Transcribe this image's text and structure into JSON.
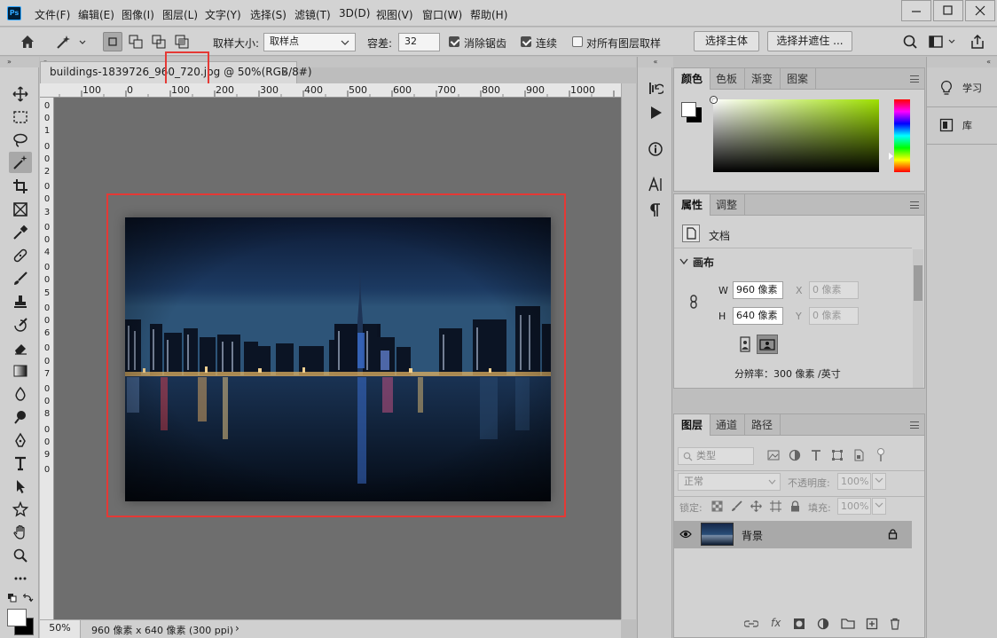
{
  "menubar": {
    "logo": "Ps",
    "items": [
      "文件(F)",
      "编辑(E)",
      "图像(I)",
      "图层(L)",
      "文字(Y)",
      "选择(S)",
      "滤镜(T)",
      "3D(D)",
      "视图(V)",
      "窗口(W)",
      "帮助(H)"
    ]
  },
  "options": {
    "sample_size_label": "取样大小:",
    "sample_size_value": "取样点",
    "tolerance_label": "容差:",
    "tolerance_value": "32",
    "antialias_label": "消除锯齿",
    "contiguous_label": "连续",
    "sample_all_label": "对所有图层取样",
    "select_subject_label": "选择主体",
    "select_mask_label": "选择并遮住 ..."
  },
  "document": {
    "tab_title": "buildings-1839726_960_720.jpg @ 50%(RGB/8#)",
    "tab_close": "×",
    "ruler_top_labels": [
      "100",
      "0",
      "100",
      "200",
      "300",
      "400",
      "500",
      "600",
      "700",
      "800",
      "900",
      "1000"
    ],
    "ruler_left_digits": [
      "0",
      "0",
      "1",
      "0",
      "0",
      "2",
      "0",
      "0",
      "3",
      "0",
      "0",
      "4",
      "0",
      "0",
      "5",
      "0",
      "0",
      "6",
      "0",
      "0",
      "7",
      "0",
      "0",
      "8",
      "0",
      "0",
      "9",
      "0"
    ],
    "zoom": "50%",
    "status_info": "960 像素 x 640 像素 (300 ppi)",
    "status_arrow": "›"
  },
  "color_panel": {
    "tabs": [
      "颜色",
      "色板",
      "渐变",
      "图案"
    ]
  },
  "properties_panel": {
    "tabs": [
      "属性",
      "调整"
    ],
    "doc_label": "文档",
    "section": "画布",
    "w_label": "W",
    "w_value": "960 像素",
    "h_label": "H",
    "h_value": "640 像素",
    "x_label": "X",
    "x_placeholder": "0 像素",
    "y_label": "Y",
    "y_placeholder": "0 像素",
    "resolution": "分辨率：300 像素 /英寸"
  },
  "layers_panel": {
    "tabs": [
      "图层",
      "通道",
      "路径"
    ],
    "filter_label": "类型",
    "blend_mode": "正常",
    "opacity_label": "不透明度:",
    "opacity_value": "100%",
    "lock_label": "锁定:",
    "fill_label": "填充:",
    "fill_value": "100%",
    "layer_name": "背景",
    "fx_label": "fx"
  },
  "far_panel": {
    "learn_label": "学习",
    "library_label": "库"
  },
  "collapse": {
    "left": "»",
    "mid": "«",
    "right": "»",
    "far": "«"
  },
  "colors": {
    "highlight_red": "#e53935",
    "canvas_bg": "#6e6e6e",
    "active_tool": "#a8a8a8"
  }
}
